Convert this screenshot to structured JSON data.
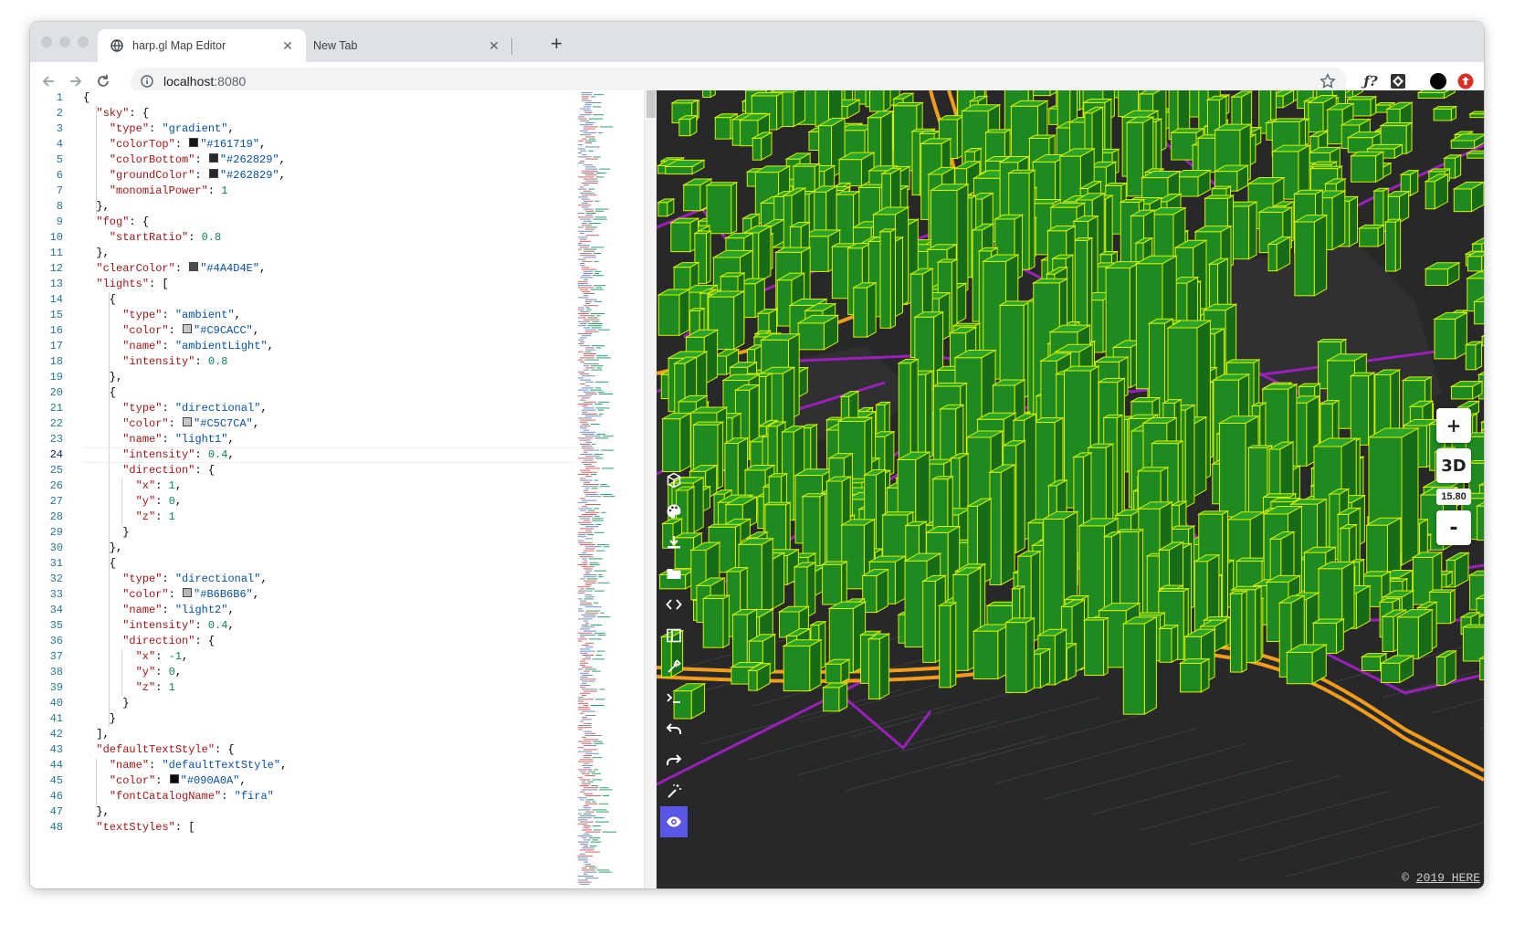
{
  "browser": {
    "tabs": [
      {
        "title": "harp.gl Map Editor",
        "active": true
      },
      {
        "title": "New Tab",
        "active": false
      }
    ],
    "url_host": "localhost",
    "url_port": ":8080",
    "extensions": [
      "star-icon",
      "function-icon",
      "extension-icon",
      "profile-icon",
      "update-icon"
    ]
  },
  "editor": {
    "current_line": 24,
    "lines": [
      [
        [
          "p",
          "{"
        ]
      ],
      [
        [
          "p",
          "  "
        ],
        [
          "k",
          "\"sky\""
        ],
        [
          "p",
          ": {"
        ]
      ],
      [
        [
          "p",
          "    "
        ],
        [
          "k",
          "\"type\""
        ],
        [
          "p",
          ": "
        ],
        [
          "s",
          "\"gradient\""
        ],
        [
          "p",
          ","
        ]
      ],
      [
        [
          "p",
          "    "
        ],
        [
          "k",
          "\"colorTop\""
        ],
        [
          "p",
          ": "
        ],
        [
          "c",
          "#161719"
        ],
        [
          "s",
          "\"#161719\""
        ],
        [
          "p",
          ","
        ]
      ],
      [
        [
          "p",
          "    "
        ],
        [
          "k",
          "\"colorBottom\""
        ],
        [
          "p",
          ": "
        ],
        [
          "c",
          "#262829"
        ],
        [
          "s",
          "\"#262829\""
        ],
        [
          "p",
          ","
        ]
      ],
      [
        [
          "p",
          "    "
        ],
        [
          "k",
          "\"groundColor\""
        ],
        [
          "p",
          ": "
        ],
        [
          "c",
          "#262829"
        ],
        [
          "s",
          "\"#262829\""
        ],
        [
          "p",
          ","
        ]
      ],
      [
        [
          "p",
          "    "
        ],
        [
          "k",
          "\"monomialPower\""
        ],
        [
          "p",
          ": "
        ],
        [
          "n",
          "1"
        ]
      ],
      [
        [
          "p",
          "  },"
        ]
      ],
      [
        [
          "p",
          "  "
        ],
        [
          "k",
          "\"fog\""
        ],
        [
          "p",
          ": {"
        ]
      ],
      [
        [
          "p",
          "    "
        ],
        [
          "k",
          "\"startRatio\""
        ],
        [
          "p",
          ": "
        ],
        [
          "n",
          "0.8"
        ]
      ],
      [
        [
          "p",
          "  },"
        ]
      ],
      [
        [
          "p",
          "  "
        ],
        [
          "k",
          "\"clearColor\""
        ],
        [
          "p",
          ": "
        ],
        [
          "c",
          "#4A4D4E"
        ],
        [
          "s",
          "\"#4A4D4E\""
        ],
        [
          "p",
          ","
        ]
      ],
      [
        [
          "p",
          "  "
        ],
        [
          "k",
          "\"lights\""
        ],
        [
          "p",
          ": ["
        ]
      ],
      [
        [
          "p",
          "    {"
        ]
      ],
      [
        [
          "p",
          "      "
        ],
        [
          "k",
          "\"type\""
        ],
        [
          "p",
          ": "
        ],
        [
          "s",
          "\"ambient\""
        ],
        [
          "p",
          ","
        ]
      ],
      [
        [
          "p",
          "      "
        ],
        [
          "k",
          "\"color\""
        ],
        [
          "p",
          ": "
        ],
        [
          "c",
          "#C9CACC"
        ],
        [
          "s",
          "\"#C9CACC\""
        ],
        [
          "p",
          ","
        ]
      ],
      [
        [
          "p",
          "      "
        ],
        [
          "k",
          "\"name\""
        ],
        [
          "p",
          ": "
        ],
        [
          "s",
          "\"ambientLight\""
        ],
        [
          "p",
          ","
        ]
      ],
      [
        [
          "p",
          "      "
        ],
        [
          "k",
          "\"intensity\""
        ],
        [
          "p",
          ": "
        ],
        [
          "n",
          "0.8"
        ]
      ],
      [
        [
          "p",
          "    },"
        ]
      ],
      [
        [
          "p",
          "    {"
        ]
      ],
      [
        [
          "p",
          "      "
        ],
        [
          "k",
          "\"type\""
        ],
        [
          "p",
          ": "
        ],
        [
          "s",
          "\"directional\""
        ],
        [
          "p",
          ","
        ]
      ],
      [
        [
          "p",
          "      "
        ],
        [
          "k",
          "\"color\""
        ],
        [
          "p",
          ": "
        ],
        [
          "c",
          "#C5C7CA"
        ],
        [
          "s",
          "\"#C5C7CA\""
        ],
        [
          "p",
          ","
        ]
      ],
      [
        [
          "p",
          "      "
        ],
        [
          "k",
          "\"name\""
        ],
        [
          "p",
          ": "
        ],
        [
          "s",
          "\"light1\""
        ],
        [
          "p",
          ","
        ]
      ],
      [
        [
          "p",
          "      "
        ],
        [
          "k",
          "\"intensity\""
        ],
        [
          "p",
          ": "
        ],
        [
          "n",
          "0.4"
        ],
        [
          "p",
          ","
        ]
      ],
      [
        [
          "p",
          "      "
        ],
        [
          "k",
          "\"direction\""
        ],
        [
          "p",
          ": {"
        ]
      ],
      [
        [
          "p",
          "        "
        ],
        [
          "k",
          "\"x\""
        ],
        [
          "p",
          ": "
        ],
        [
          "n",
          "1"
        ],
        [
          "p",
          ","
        ]
      ],
      [
        [
          "p",
          "        "
        ],
        [
          "k",
          "\"y\""
        ],
        [
          "p",
          ": "
        ],
        [
          "n",
          "0"
        ],
        [
          "p",
          ","
        ]
      ],
      [
        [
          "p",
          "        "
        ],
        [
          "k",
          "\"z\""
        ],
        [
          "p",
          ": "
        ],
        [
          "n",
          "1"
        ]
      ],
      [
        [
          "p",
          "      }"
        ]
      ],
      [
        [
          "p",
          "    },"
        ]
      ],
      [
        [
          "p",
          "    {"
        ]
      ],
      [
        [
          "p",
          "      "
        ],
        [
          "k",
          "\"type\""
        ],
        [
          "p",
          ": "
        ],
        [
          "s",
          "\"directional\""
        ],
        [
          "p",
          ","
        ]
      ],
      [
        [
          "p",
          "      "
        ],
        [
          "k",
          "\"color\""
        ],
        [
          "p",
          ": "
        ],
        [
          "c",
          "#B6B6B6"
        ],
        [
          "s",
          "\"#B6B6B6\""
        ],
        [
          "p",
          ","
        ]
      ],
      [
        [
          "p",
          "      "
        ],
        [
          "k",
          "\"name\""
        ],
        [
          "p",
          ": "
        ],
        [
          "s",
          "\"light2\""
        ],
        [
          "p",
          ","
        ]
      ],
      [
        [
          "p",
          "      "
        ],
        [
          "k",
          "\"intensity\""
        ],
        [
          "p",
          ": "
        ],
        [
          "n",
          "0.4"
        ],
        [
          "p",
          ","
        ]
      ],
      [
        [
          "p",
          "      "
        ],
        [
          "k",
          "\"direction\""
        ],
        [
          "p",
          ": {"
        ]
      ],
      [
        [
          "p",
          "        "
        ],
        [
          "k",
          "\"x\""
        ],
        [
          "p",
          ": "
        ],
        [
          "n",
          "-1"
        ],
        [
          "p",
          ","
        ]
      ],
      [
        [
          "p",
          "        "
        ],
        [
          "k",
          "\"y\""
        ],
        [
          "p",
          ": "
        ],
        [
          "n",
          "0"
        ],
        [
          "p",
          ","
        ]
      ],
      [
        [
          "p",
          "        "
        ],
        [
          "k",
          "\"z\""
        ],
        [
          "p",
          ": "
        ],
        [
          "n",
          "1"
        ]
      ],
      [
        [
          "p",
          "      }"
        ]
      ],
      [
        [
          "p",
          "    }"
        ]
      ],
      [
        [
          "p",
          "  ],"
        ]
      ],
      [
        [
          "p",
          "  "
        ],
        [
          "k",
          "\"defaultTextStyle\""
        ],
        [
          "p",
          ": {"
        ]
      ],
      [
        [
          "p",
          "    "
        ],
        [
          "k",
          "\"name\""
        ],
        [
          "p",
          ": "
        ],
        [
          "s",
          "\"defaultTextStyle\""
        ],
        [
          "p",
          ","
        ]
      ],
      [
        [
          "p",
          "    "
        ],
        [
          "k",
          "\"color\""
        ],
        [
          "p",
          ": "
        ],
        [
          "c",
          "#090A0A"
        ],
        [
          "s",
          "\"#090A0A\""
        ],
        [
          "p",
          ","
        ]
      ],
      [
        [
          "p",
          "    "
        ],
        [
          "k",
          "\"fontCatalogName\""
        ],
        [
          "p",
          ": "
        ],
        [
          "s",
          "\"fira\""
        ]
      ],
      [
        [
          "p",
          "  },"
        ]
      ],
      [
        [
          "p",
          "  "
        ],
        [
          "k",
          "\"textStyles\""
        ],
        [
          "p",
          ": ["
        ]
      ]
    ]
  },
  "map": {
    "tools": [
      {
        "name": "cube-icon",
        "active": false
      },
      {
        "name": "palette-icon",
        "active": false
      },
      {
        "name": "download-icon",
        "active": false
      },
      {
        "name": "folder-icon",
        "active": false
      },
      {
        "name": "code-icon",
        "active": false
      },
      {
        "name": "sidebar-toggle-icon",
        "active": false
      },
      {
        "name": "eyedropper-icon",
        "active": false
      },
      {
        "name": "terminal-icon",
        "active": false
      },
      {
        "name": "undo-icon",
        "active": false
      },
      {
        "name": "redo-icon",
        "active": false
      },
      {
        "name": "magic-wand-icon",
        "active": false
      },
      {
        "name": "eye-icon",
        "active": true
      }
    ],
    "zoom_in_label": "+",
    "view_mode_label": "3D",
    "zoom_level": "15.80",
    "zoom_out_label": "-",
    "copyright_prefix": "© ",
    "copyright_link": "2019 HERE",
    "colors": {
      "building_fill": "#1f8a1f",
      "building_edge": "#d8f000",
      "major_road": "#f39c1b",
      "arterial_road": "#a21fc4",
      "ground": "#262829",
      "active_tool": "#5a56e8"
    }
  }
}
